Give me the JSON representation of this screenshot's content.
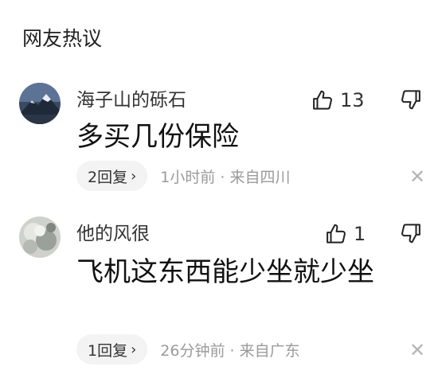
{
  "section": {
    "title": "网友热议"
  },
  "comments": [
    {
      "username": "海子山的砾石",
      "likes": "13",
      "text": "多买几份保险",
      "reply_label": "2回复",
      "meta": "1小时前 · 来自四川"
    },
    {
      "username": "他的风很",
      "likes": "1",
      "text": "飞机这东西能少坐就少坐",
      "reply_label": "1回复",
      "meta": "26分钟前 · 来自广东"
    }
  ],
  "icons": {
    "like": "thumb-up-outline",
    "dislike": "thumb-down-outline",
    "close": "close-x",
    "reply_chevron": "chevron-right"
  },
  "colors": {
    "text_primary": "#111111",
    "text_secondary": "#9a9a9a",
    "pill_bg": "#f3f3f3",
    "close_gray": "#b5b5b5"
  }
}
